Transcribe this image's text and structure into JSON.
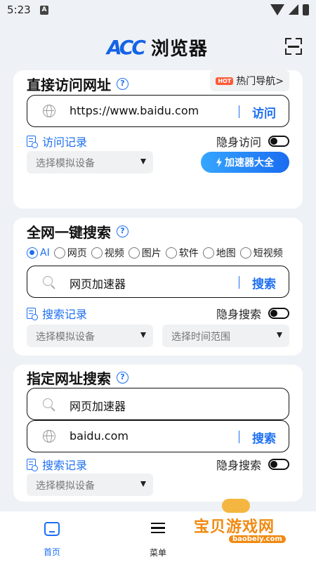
{
  "status_bar": {
    "time": "5:23",
    "sim_label": "A"
  },
  "header": {
    "logo_mark": "ACC",
    "app_title": "浏览器",
    "scan_icon": "scan-icon"
  },
  "direct_visit": {
    "title": "直接访问网址",
    "hot_badge": "HOT",
    "hot_nav_label": "热门导航>",
    "url_value": "https://www.baidu.com",
    "visit_label": "访问",
    "history_label": "访问记录",
    "incognito_label": "隐身访问",
    "device_select": "选择模拟设备",
    "accelerator_label": "加速器大全"
  },
  "web_search": {
    "title": "全网一键搜索",
    "radios": [
      {
        "label": "AI",
        "selected": true
      },
      {
        "label": "网页",
        "selected": false
      },
      {
        "label": "视频",
        "selected": false
      },
      {
        "label": "图片",
        "selected": false
      },
      {
        "label": "软件",
        "selected": false
      },
      {
        "label": "地图",
        "selected": false
      },
      {
        "label": "短视频",
        "selected": false
      }
    ],
    "query_value": "网页加速器",
    "search_label": "搜索",
    "history_label": "搜索记录",
    "incognito_label": "隐身搜索",
    "device_select": "选择模拟设备",
    "time_select": "选择时间范围"
  },
  "site_search": {
    "title": "指定网址搜索",
    "query_value": "网页加速器",
    "site_value": "baidu.com",
    "search_label": "搜索",
    "history_label": "搜索记录",
    "incognito_label": "隐身搜索",
    "device_select": "选择模拟设备"
  },
  "bottom_nav": {
    "items": [
      {
        "label": "首页",
        "icon": "home-icon",
        "active": true
      },
      {
        "label": "菜单",
        "icon": "menu-icon",
        "active": false
      }
    ]
  },
  "watermark": {
    "text": "宝贝游戏网",
    "url": "baobeiy.com"
  },
  "colors": {
    "accent": "#1d6ff2",
    "hot": "#ff5a36",
    "background": "#eef1f5"
  }
}
